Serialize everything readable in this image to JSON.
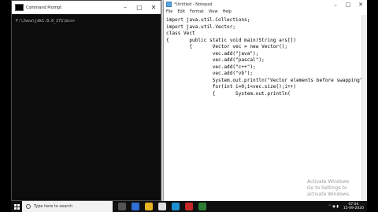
{
  "cmd": {
    "title": "Command Prompt",
    "prompt_line": "F:\\Java\\jdk1.8.0_271\\bin>"
  },
  "notepad": {
    "title": "*Untitled - Notepad",
    "menu": [
      "File",
      "Edit",
      "Format",
      "View",
      "Help"
    ],
    "lines": [
      "import java.util.Collections;",
      "import java.util.Vector;",
      "class Vect",
      "{       public static void main(String ars[])",
      "        {       Vector vec = new Vector();",
      "                vec.add(\"java\");",
      "                vec.add(\"pascal\");",
      "                vec.add(\"c++\");",
      "                vec.add(\"vb\");",
      "                System.out.println(\"Vector elements before swapping\")",
      "                for(int i=0;i<vec.size();i++)",
      "                {       System.out.println("
    ]
  },
  "watermark": {
    "line1": "Activate Windows",
    "line2": "Go to Settings to activate Windows."
  },
  "taskbar": {
    "search_placeholder": "Type here to search",
    "time": "07:04",
    "date": "15-09-2020",
    "icon_colors": [
      "#2f6fd6",
      "#e6b422",
      "#e0e0e0",
      "#1e8fd1",
      "#c62828",
      "#2e7d32",
      "#555555"
    ]
  }
}
